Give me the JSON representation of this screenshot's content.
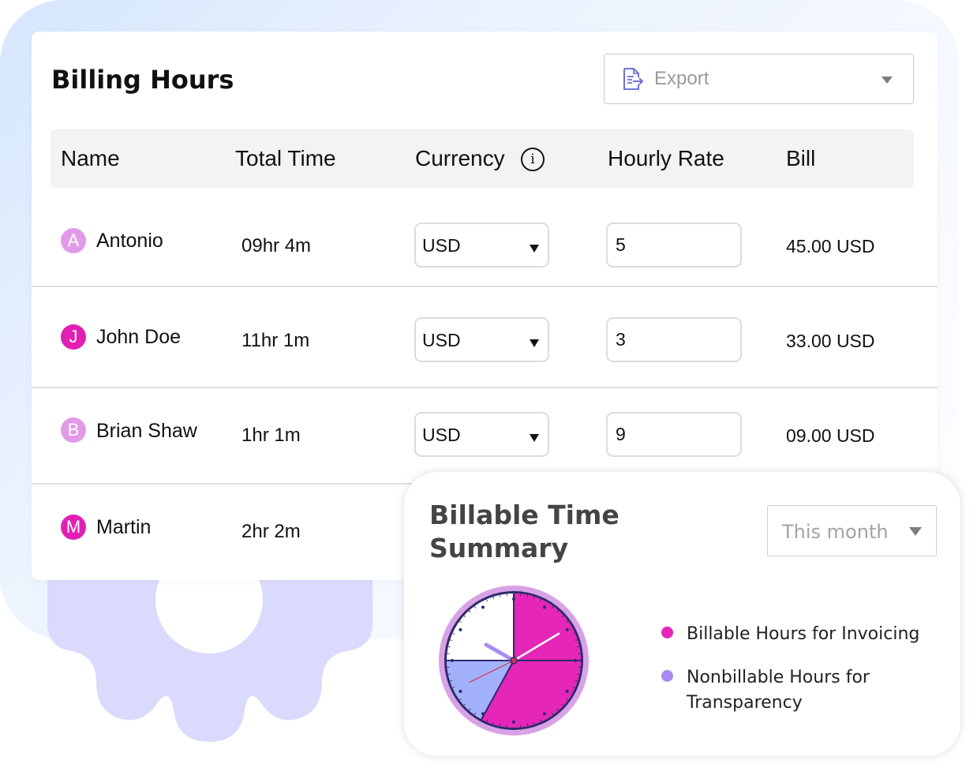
{
  "billing": {
    "title": "Billing Hours",
    "export": {
      "label": "Export",
      "icon": "document-export-icon"
    },
    "columns": {
      "name": "Name",
      "total_time": "Total Time",
      "currency": "Currency",
      "hourly_rate": "Hourly Rate",
      "bill": "Bill"
    },
    "rows": [
      {
        "initial": "A",
        "name": "Antonio",
        "total_time": "09hr 4m",
        "currency": "USD",
        "rate": "5",
        "bill": "45.00 USD",
        "avatar_color": "#e29ae8"
      },
      {
        "initial": "J",
        "name": "John Doe",
        "total_time": "11hr 1m",
        "currency": "USD",
        "rate": "3",
        "bill": "33.00 USD",
        "avatar_color": "#e11fb4"
      },
      {
        "initial": "B",
        "name": "Brian Shaw",
        "total_time": "1hr 1m",
        "currency": "USD",
        "rate": "9",
        "bill": "09.00 USD",
        "avatar_color": "#e29ae8"
      },
      {
        "initial": "M",
        "name": "Martin",
        "total_time": "2hr 2m",
        "currency": "",
        "rate": "",
        "bill": "",
        "avatar_color": "#e11fb4"
      }
    ]
  },
  "summary": {
    "title": "Billable Time Summary",
    "period": "This month",
    "legend": [
      {
        "label": "Billable Hours for Invoicing",
        "color": "#e526b8"
      },
      {
        "label": "Nonbillable Hours for Transparency",
        "color": "#a88bf2"
      }
    ],
    "clock": {
      "billable_fraction": 0.58,
      "nonbillable_fraction": 0.17,
      "colors": {
        "billable": "#e526b8",
        "nonbillable": "#a3b1fb",
        "ring": "#d8a2e6",
        "outline": "#2e2a6b"
      }
    }
  },
  "colors": {
    "accent": "#e526b8",
    "gear": "#dadafc",
    "background": "#e8f0fe"
  }
}
